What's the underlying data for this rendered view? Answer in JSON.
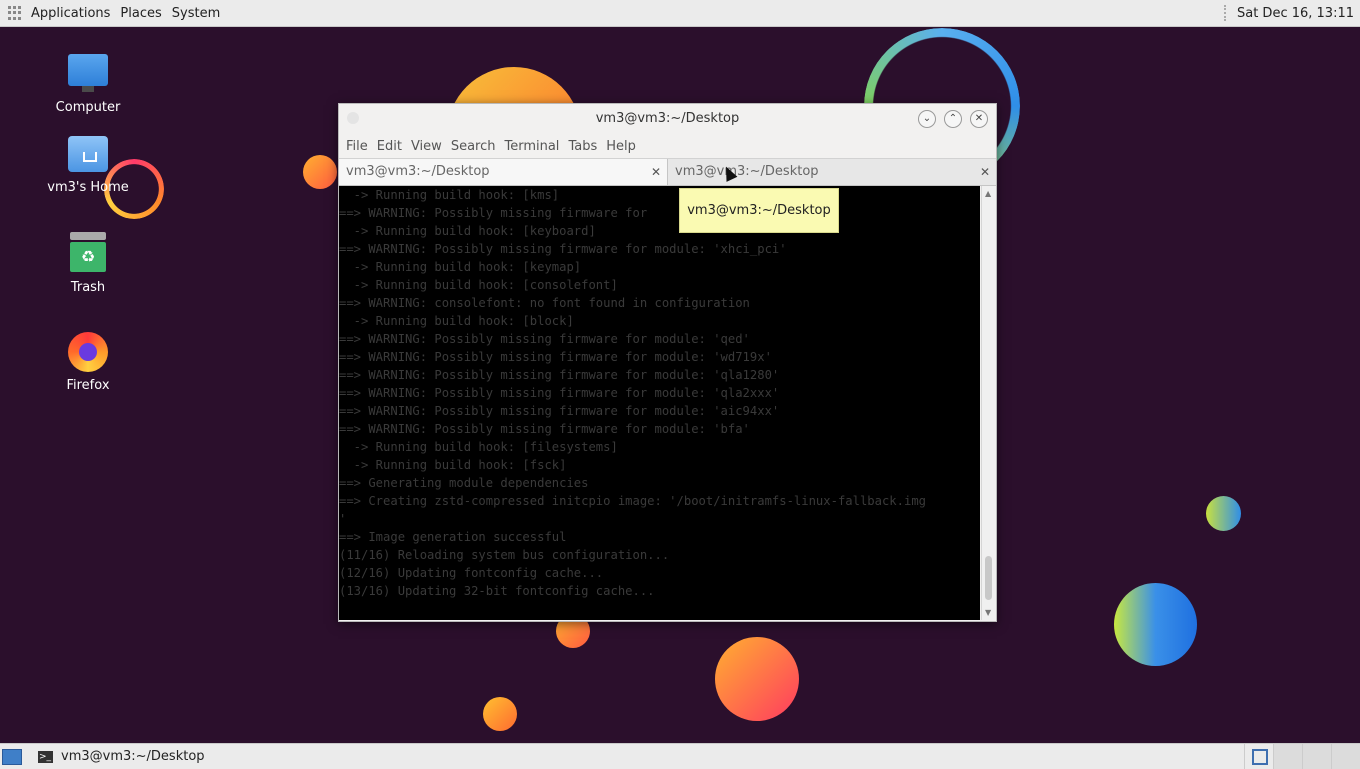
{
  "top_panel": {
    "menus": [
      "Applications",
      "Places",
      "System"
    ],
    "clock": "Sat Dec 16, 13:11"
  },
  "desktop": {
    "icons": [
      {
        "label": "Computer",
        "icon": "computer-icon"
      },
      {
        "label": "vm3's Home",
        "icon": "home-folder-icon"
      },
      {
        "label": "Trash",
        "icon": "trash-icon"
      },
      {
        "label": "Firefox",
        "icon": "firefox-icon"
      }
    ]
  },
  "window": {
    "title": "vm3@vm3:~/Desktop",
    "menu": [
      "File",
      "Edit",
      "View",
      "Search",
      "Terminal",
      "Tabs",
      "Help"
    ],
    "tabs": [
      {
        "label": "vm3@vm3:~/Desktop",
        "active": true
      },
      {
        "label": "vm3@vm3:~/Desktop",
        "active": false
      }
    ],
    "terminal_lines": [
      "  -> Running build hook: [kms]",
      "==> WARNING: Possibly missing firmware for",
      "  -> Running build hook: [keyboard]",
      "==> WARNING: Possibly missing firmware for module: 'xhci_pci'",
      "  -> Running build hook: [keymap]",
      "  -> Running build hook: [consolefont]",
      "==> WARNING: consolefont: no font found in configuration",
      "  -> Running build hook: [block]",
      "==> WARNING: Possibly missing firmware for module: 'qed'",
      "==> WARNING: Possibly missing firmware for module: 'wd719x'",
      "==> WARNING: Possibly missing firmware for module: 'qla1280'",
      "==> WARNING: Possibly missing firmware for module: 'qla2xxx'",
      "==> WARNING: Possibly missing firmware for module: 'aic94xx'",
      "==> WARNING: Possibly missing firmware for module: 'bfa'",
      "  -> Running build hook: [filesystems]",
      "  -> Running build hook: [fsck]",
      "==> Generating module dependencies",
      "==> Creating zstd-compressed initcpio image: '/boot/initramfs-linux-fallback.img",
      "'",
      "==> Image generation successful",
      "(11/16) Reloading system bus configuration...",
      "(12/16) Updating fontconfig cache...",
      "(13/16) Updating 32-bit fontconfig cache..."
    ]
  },
  "tooltip": {
    "text": "vm3@vm3:~/Desktop"
  },
  "bottom_panel": {
    "task_label": "vm3@vm3:~/Desktop"
  }
}
